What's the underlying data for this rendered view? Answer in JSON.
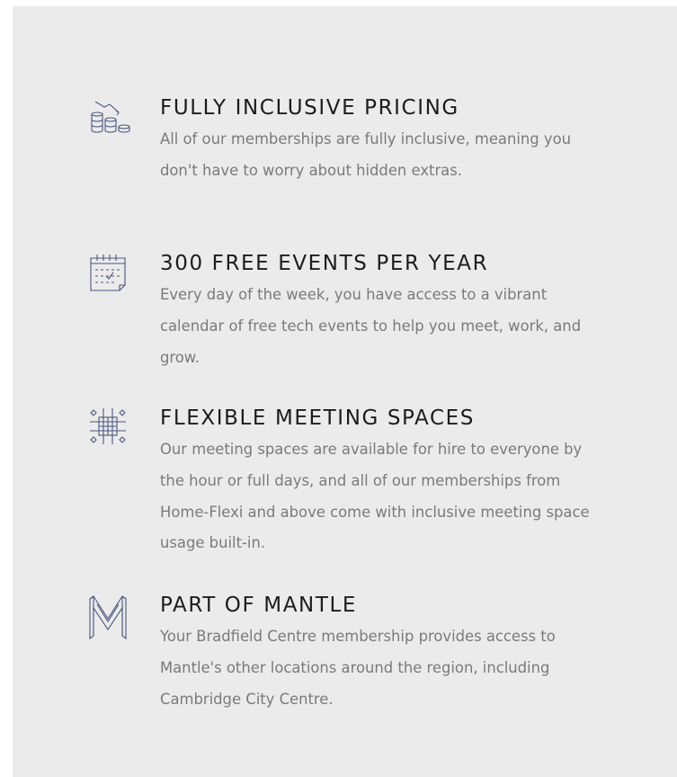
{
  "features": [
    {
      "icon": "coin-stacks-icon",
      "title": "FULLY INCLUSIVE PRICING",
      "description": "All of our memberships are fully inclusive, meaning you don't have to worry about hidden extras."
    },
    {
      "icon": "calendar-icon",
      "title": "300 FREE EVENTS PER YEAR",
      "description": "Every day of the week, you have access to a vibrant calendar of free tech events to help you meet, work, and grow."
    },
    {
      "icon": "meeting-table-icon",
      "title": "FLEXIBLE MEETING SPACES",
      "description": "Our meeting spaces are available for hire to everyone by the hour or full days, and all of our memberships from Home-Flexi and above come with inclusive meeting space usage built-in."
    },
    {
      "icon": "mantle-m-logo-icon",
      "title": "PART OF MANTLE",
      "description": "Your Bradfield Centre membership provides access to Mantle's other locations around the region, including Cambridge City Centre."
    }
  ],
  "colors": {
    "panel_background": "#ebebeb",
    "heading": "#1c1c1c",
    "body_text": "#7a7a7a",
    "icon_stroke": "#4a5680"
  }
}
